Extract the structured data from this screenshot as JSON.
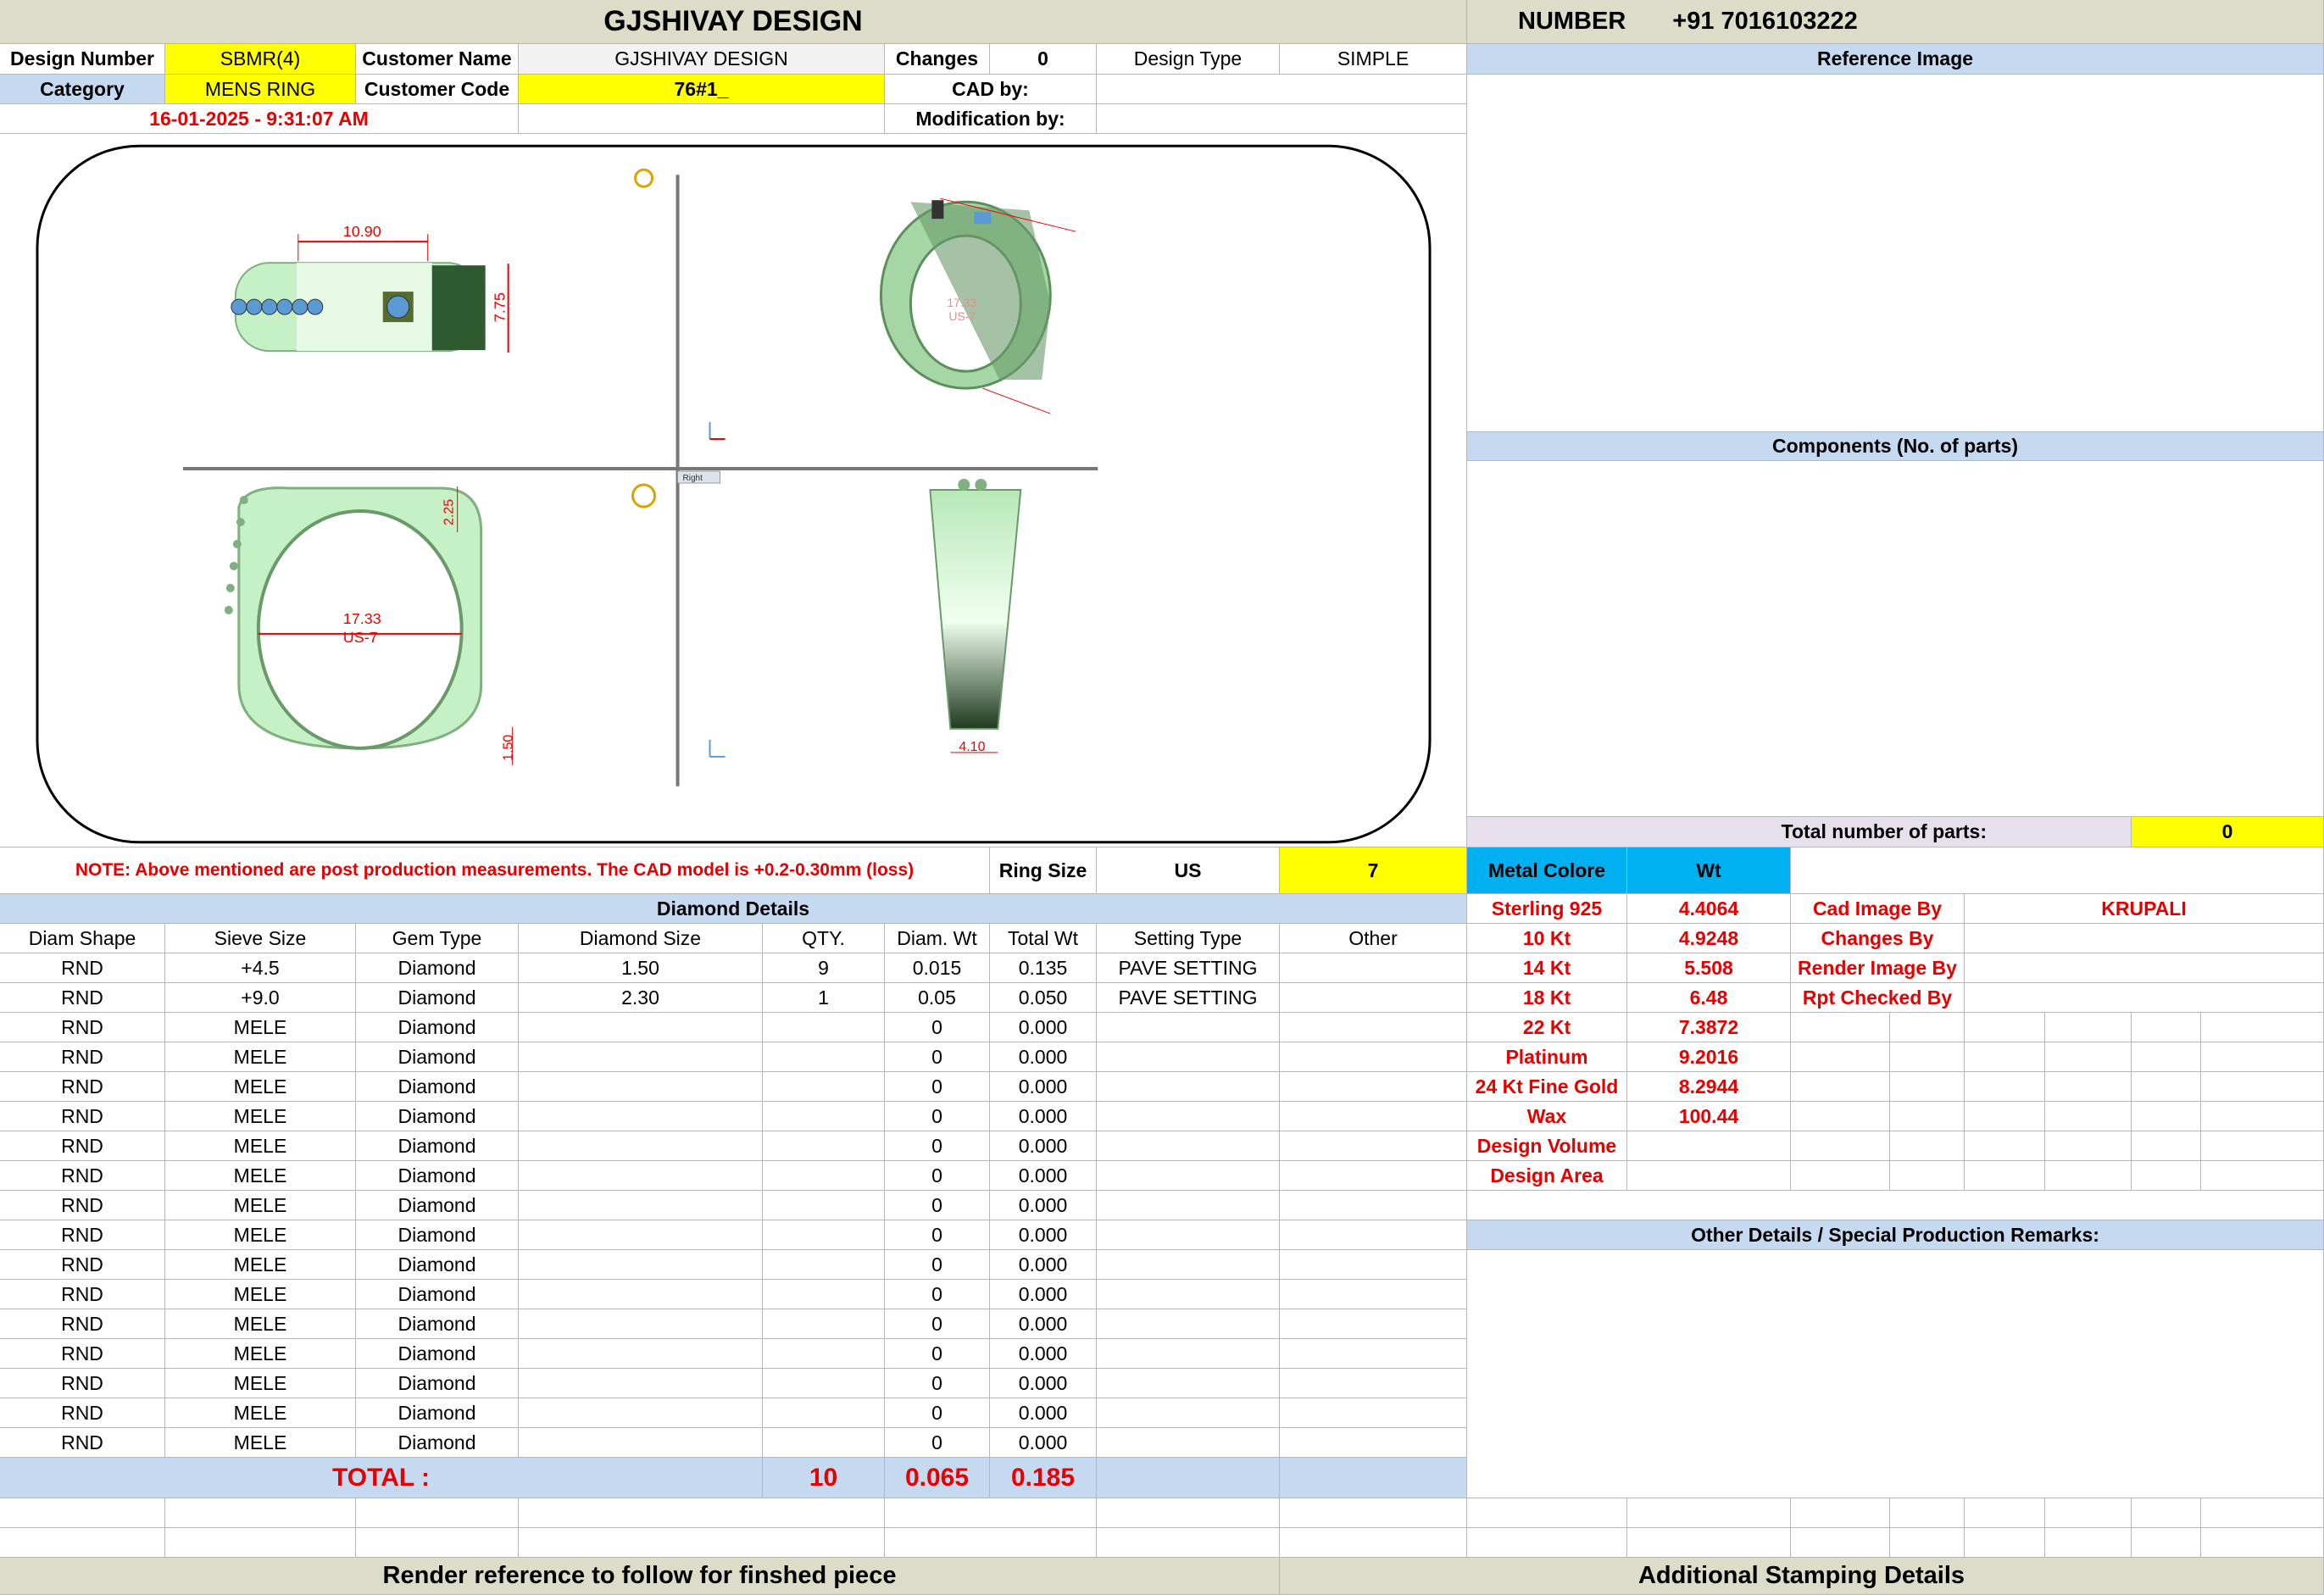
{
  "header": {
    "title": "GJSHIVAY DESIGN",
    "number_label": "NUMBER",
    "number_value": "+91 7016103222"
  },
  "info": {
    "design_number_label": "Design Number",
    "design_number_value": "SBMR(4)",
    "customer_name_label": "Customer Name",
    "customer_name_value": "GJSHIVAY DESIGN",
    "changes_label": "Changes",
    "changes_value": "0",
    "design_type_label": "Design Type",
    "design_type_value": "SIMPLE",
    "category_label": "Category",
    "category_value": "MENS RING",
    "customer_code_label": "Customer Code",
    "customer_code_value": "76#1_",
    "cad_by_label": "CAD by:",
    "modification_by_label": "Modification by:",
    "timestamp": "16-01-2025 - 9:31:07 AM"
  },
  "right_panel": {
    "reference_image": "Reference Image",
    "components": "Components (No. of parts)",
    "total_parts_label": "Total number of parts:",
    "total_parts_value": "0",
    "other_details": "Other Details / Special Production Remarks:"
  },
  "drawing": {
    "dim_width": "10.90",
    "dim_height": "7.75",
    "dim_top": "2.25",
    "dim_inner": "17.33",
    "dim_us": "US-7",
    "dim_bottom": "1.50",
    "dim_shank": "4.10",
    "view_label": "Right"
  },
  "note": {
    "text": "NOTE: Above mentioned are post production measurements. The CAD model is +0.2-0.30mm (loss)",
    "ring_size_label": "Ring Size",
    "ring_size_unit": "US",
    "ring_size_value": "7",
    "metal_colore": "Metal Colore",
    "wt": "Wt"
  },
  "diamond": {
    "section_title": "Diamond Details",
    "columns": [
      "Diam Shape",
      "Sieve Size",
      "Gem Type",
      "Diamond Size",
      "QTY.",
      "Diam. Wt",
      "Total Wt",
      "Setting Type",
      "Other"
    ],
    "rows": [
      [
        "RND",
        "+4.5",
        "Diamond",
        "1.50",
        "9",
        "0.015",
        "0.135",
        "PAVE SETTING",
        ""
      ],
      [
        "RND",
        "+9.0",
        "Diamond",
        "2.30",
        "1",
        "0.05",
        "0.050",
        "PAVE SETTING",
        ""
      ],
      [
        "RND",
        "MELE",
        "Diamond",
        "",
        "",
        "0",
        "0.000",
        "",
        ""
      ],
      [
        "RND",
        "MELE",
        "Diamond",
        "",
        "",
        "0",
        "0.000",
        "",
        ""
      ],
      [
        "RND",
        "MELE",
        "Diamond",
        "",
        "",
        "0",
        "0.000",
        "",
        ""
      ],
      [
        "RND",
        "MELE",
        "Diamond",
        "",
        "",
        "0",
        "0.000",
        "",
        ""
      ],
      [
        "RND",
        "MELE",
        "Diamond",
        "",
        "",
        "0",
        "0.000",
        "",
        ""
      ],
      [
        "RND",
        "MELE",
        "Diamond",
        "",
        "",
        "0",
        "0.000",
        "",
        ""
      ],
      [
        "RND",
        "MELE",
        "Diamond",
        "",
        "",
        "0",
        "0.000",
        "",
        ""
      ],
      [
        "RND",
        "MELE",
        "Diamond",
        "",
        "",
        "0",
        "0.000",
        "",
        ""
      ],
      [
        "RND",
        "MELE",
        "Diamond",
        "",
        "",
        "0",
        "0.000",
        "",
        ""
      ],
      [
        "RND",
        "MELE",
        "Diamond",
        "",
        "",
        "0",
        "0.000",
        "",
        ""
      ],
      [
        "RND",
        "MELE",
        "Diamond",
        "",
        "",
        "0",
        "0.000",
        "",
        ""
      ],
      [
        "RND",
        "MELE",
        "Diamond",
        "",
        "",
        "0",
        "0.000",
        "",
        ""
      ],
      [
        "RND",
        "MELE",
        "Diamond",
        "",
        "",
        "0",
        "0.000",
        "",
        ""
      ],
      [
        "RND",
        "MELE",
        "Diamond",
        "",
        "",
        "0",
        "0.000",
        "",
        ""
      ],
      [
        "RND",
        "MELE",
        "Diamond",
        "",
        "",
        "0",
        "0.000",
        "",
        ""
      ]
    ],
    "total_label": "TOTAL :",
    "total_qty": "10",
    "total_diam_wt": "0.065",
    "total_wt": "0.185"
  },
  "metals": [
    {
      "name": "Sterling 925",
      "wt": "4.4064"
    },
    {
      "name": "10 Kt",
      "wt": "4.9248"
    },
    {
      "name": "14 Kt",
      "wt": "5.508"
    },
    {
      "name": "18 Kt",
      "wt": "6.48"
    },
    {
      "name": "22 Kt",
      "wt": "7.3872"
    },
    {
      "name": "Platinum",
      "wt": "9.2016"
    },
    {
      "name": "24 Kt Fine Gold",
      "wt": "8.2944"
    },
    {
      "name": "Wax",
      "wt": "100.44"
    },
    {
      "name": "Design Volume",
      "wt": ""
    },
    {
      "name": "Design Area",
      "wt": ""
    }
  ],
  "credits": [
    {
      "label": "Cad Image By",
      "value": "KRUPALI"
    },
    {
      "label": "Changes By",
      "value": ""
    },
    {
      "label": "Render Image By",
      "value": ""
    },
    {
      "label": "Rpt Checked By",
      "value": ""
    }
  ],
  "footer": {
    "render_ref": "Render reference to follow for finshed piece",
    "stamping": "Additional Stamping Details"
  },
  "colors": {
    "yellow": "#ffff00",
    "header_bg": "#dcdcc9",
    "blue_bg": "#c5d9f1",
    "red_text": "#e60000",
    "cyan": "#00b0f0",
    "ring_green": "#c6f0c6"
  }
}
